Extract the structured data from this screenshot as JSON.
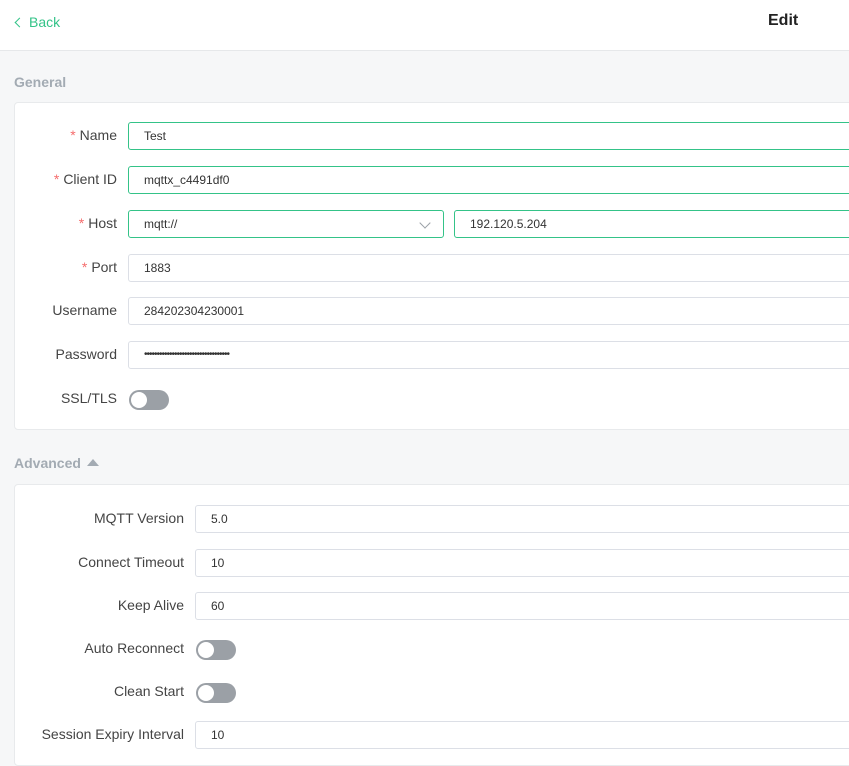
{
  "header": {
    "back_label": "Back",
    "title": "Edit"
  },
  "general": {
    "section_title": "General",
    "name": {
      "label": "Name",
      "value": "Test"
    },
    "client_id": {
      "label": "Client ID",
      "value": "mqttx_c4491df0"
    },
    "host": {
      "label": "Host",
      "protocol": "mqtt://",
      "value": "192.120.5.204"
    },
    "port": {
      "label": "Port",
      "value": "1883"
    },
    "username": {
      "label": "Username",
      "value": "284202304230001"
    },
    "password": {
      "label": "Password",
      "value": "••••••••••••••••••••••••••••••••••"
    },
    "ssl": {
      "label": "SSL/TLS",
      "enabled": false
    }
  },
  "advanced": {
    "section_title": "Advanced",
    "mqtt_version": {
      "label": "MQTT Version",
      "value": "5.0"
    },
    "connect_timeout": {
      "label": "Connect Timeout",
      "value": "10"
    },
    "keep_alive": {
      "label": "Keep Alive",
      "value": "60"
    },
    "auto_reconnect": {
      "label": "Auto Reconnect",
      "enabled": false
    },
    "clean_start": {
      "label": "Clean Start",
      "enabled": false
    },
    "session_expiry": {
      "label": "Session Expiry Interval",
      "value": "10"
    }
  },
  "colors": {
    "accent": "#34c388",
    "required": "#f56c6c",
    "toggle_off": "#9ba0a6",
    "section": "#a3abb3"
  },
  "icons": {
    "back": "chevron-left-icon",
    "select": "chevron-down-icon",
    "collapse": "caret-up-icon"
  }
}
